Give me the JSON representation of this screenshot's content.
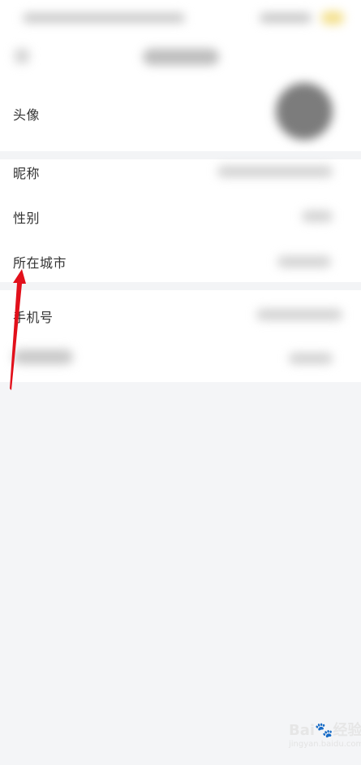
{
  "profile_rows": [
    {
      "label": "头像"
    },
    {
      "label": "昵称"
    },
    {
      "label": "性别"
    },
    {
      "label": "所在城市"
    },
    {
      "label": "手机号"
    }
  ],
  "watermark": {
    "brand": "Bai",
    "suffix": "经验",
    "url": "jingyan.baidu.com"
  },
  "colors": {
    "annotation": "#e2101b",
    "page_bg": "#f4f5f7",
    "card_bg": "#ffffff"
  },
  "icons": [
    "avatar-image",
    "baidu-paw-icon",
    "annotation-arrow"
  ]
}
